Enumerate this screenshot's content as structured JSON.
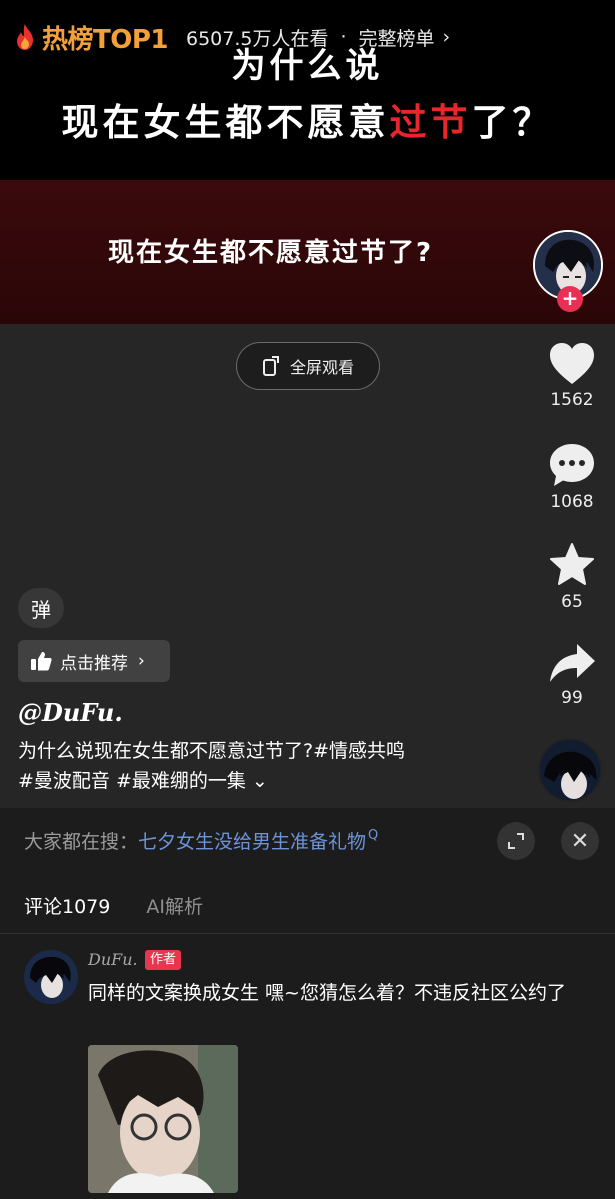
{
  "banner": {
    "line1": "为什么说",
    "line2_prefix": "现在女生都不愿意",
    "line2_highlight": "过节",
    "line2_suffix": "了？"
  },
  "hot_list": {
    "tag": "热榜TOP1",
    "viewers": "6507.5万人在看",
    "separator": "·",
    "full_list": "完整榜单",
    "arrow": "›",
    "title": "现在女生都不愿意过节了?"
  },
  "video": {
    "fullscreen_label": "全屏观看"
  },
  "actions": {
    "follow_plus": "+",
    "likes": "1562",
    "comments": "1068",
    "favorites": "65",
    "shares": "99"
  },
  "overlay": {
    "danmaku": "弹",
    "recommend_label": "点击推荐",
    "recommend_arrow": "›",
    "author": "@DuFu.",
    "caption_line1": "为什么说现在女生都不愿意过节了?#情感共鸣",
    "caption_line2": "#曼波配音 #最难绷的一集 ⌄"
  },
  "comments_panel": {
    "search_prefix": "大家都在搜：",
    "search_query": "七夕女生没给男生准备礼物",
    "search_glyph": "Q",
    "close_icon": "✕",
    "tabs": [
      {
        "label": "评论1079"
      },
      {
        "label": "AI解析"
      }
    ],
    "comment": {
      "author": "DuFu.",
      "badge": "作者",
      "text": "同样的文案换成女生 嘿~您猜怎么着？不违反社区公约了"
    }
  },
  "colors": {
    "hot_orange": "#f4a03a",
    "highlight_red": "#e8262b",
    "search_blue": "#6d93d8",
    "badge_pink": "#e8364f",
    "follow_pink": "#ea2f55"
  }
}
